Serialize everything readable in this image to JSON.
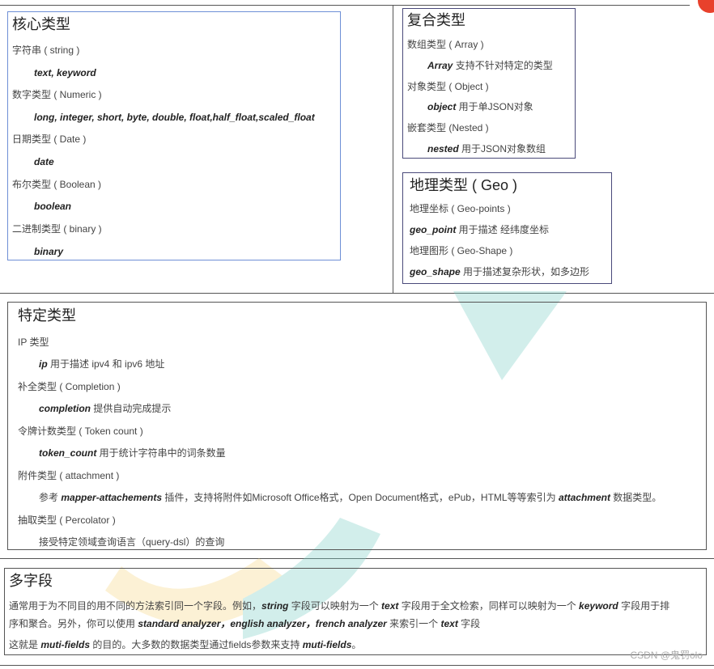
{
  "core": {
    "title": "核心类型",
    "string_label": "字符串 ( string )",
    "string_types": "text, keyword",
    "numeric_label": "数字类型 ( Numeric )",
    "numeric_types": "long, integer, short, byte, double, float,half_float,scaled_float",
    "date_label": "日期类型 ( Date )",
    "date_types": "date",
    "boolean_label": "布尔类型 ( Boolean )",
    "boolean_types": "boolean",
    "binary_label": "二进制类型 ( binary )",
    "binary_types": "binary"
  },
  "complex": {
    "title": "复合类型",
    "array_label": "数组类型 ( Array )",
    "array_kw": "Array",
    "array_desc": " 支持不针对特定的类型",
    "object_label": "对象类型 ( Object )",
    "object_kw": "object",
    "object_desc": " 用于单JSON对象",
    "nested_label": "嵌套类型 (Nested )",
    "nested_kw": "nested",
    "nested_desc": " 用于JSON对象数组"
  },
  "geo": {
    "title": "地理类型 ( Geo )",
    "points_label": "地理坐标 ( Geo-points )",
    "point_kw": "geo_point",
    "point_desc": " 用于描述 经纬度坐标",
    "shape_label": "地理图形 ( Geo-Shape )",
    "shape_kw": "geo_shape",
    "shape_desc": " 用于描述复杂形状，如多边形"
  },
  "special": {
    "title": "特定类型",
    "ip_label": "IP 类型",
    "ip_kw": "ip",
    "ip_desc": " 用于描述 ipv4 和 ipv6 地址",
    "completion_label": "补全类型 ( Completion  )",
    "completion_kw": "completion",
    "completion_desc": " 提供自动完成提示",
    "token_label": "令牌计数类型 ( Token count )",
    "token_kw": "token_count",
    "token_desc": " 用于统计字符串中的词条数量",
    "attachment_label": "附件类型 ( attachment )",
    "attachment_pre": "参考 ",
    "attachment_kw1": "mapper-attachements",
    "attachment_mid": " 插件，支持将附件如Microsoft Office格式，Open Document格式，ePub，HTML等等索引为 ",
    "attachment_kw2": "attachment",
    "attachment_post": " 数据类型。",
    "percolator_label": "抽取类型 ( Percolator )",
    "percolator_desc": "接受特定领域查询语言（query-dsl）的查询"
  },
  "multi": {
    "title": "多字段",
    "p1_a": "通常用于为不同目的用不同的方法索引同一个字段。例如，",
    "p1_b": "string",
    "p1_c": " 字段可以映射为一个 ",
    "p1_d": "text",
    "p1_e": " 字段用于全文检索，同样可以映射为一个 ",
    "p1_f": "keyword",
    "p1_g": " 字段用于排",
    "p2_a": "序和聚合。另外，你可以使用 ",
    "p2_b": "standard analyzer，english analyzer，french analyzer",
    "p2_c": " 来索引一个 ",
    "p2_d": "text",
    "p2_e": " 字段",
    "p3_a": "这就是 ",
    "p3_b": "muti-fields",
    "p3_c": " 的目的。大多数的数据类型通过fields参数来支持 ",
    "p3_d": "muti-fields",
    "p3_e": "。"
  },
  "watermark": "CSDN @鬼罚olo",
  "colors": {
    "badge": "#e8412c",
    "core_border": "#6e8fd6",
    "deco_yellow": "#f7d98a",
    "deco_teal": "#7fd0c8"
  }
}
